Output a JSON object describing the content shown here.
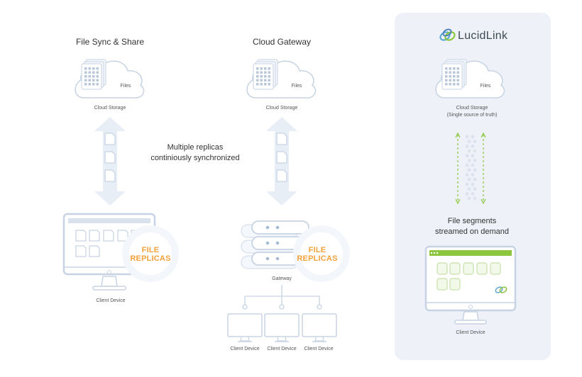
{
  "colors": {
    "panel_bg": "#eef2f8",
    "line": "#c7d3e3",
    "fill": "#f4f7fb",
    "replica_text": "#f2a23b",
    "segment_green": "#8cc63f",
    "segment_dots": "#dce3ee",
    "doc_lines": "#b9c7da"
  },
  "sync_share": {
    "title": "File Sync & Share",
    "cloud_files_label": "Files",
    "cloud_label": "Cloud Storage",
    "replicas_line1": "FILE",
    "replicas_line2": "REPLICAS",
    "device_label": "Client Device"
  },
  "middle_note": {
    "line1": "Multiple replicas",
    "line2": "continiously synchronized"
  },
  "cloud_gateway": {
    "title": "Cloud Gateway",
    "cloud_files_label": "Files",
    "cloud_label": "Cloud Storage",
    "replicas_line1": "FILE",
    "replicas_line2": "REPLICAS",
    "gateway_label": "Gateway",
    "clients": [
      "Client Device",
      "Client Device",
      "Client Device"
    ]
  },
  "lucidlink": {
    "brand_name": "LucidLink",
    "logo_icon": "lucidlink-logo-icon",
    "cloud_files_label": "Files",
    "cloud_label_line1": "Cloud Storage",
    "cloud_label_line2": "(Single source of truth)",
    "segments_line1": "File segments",
    "segments_line2": "streamed on demand",
    "device_label": "Client Device"
  }
}
